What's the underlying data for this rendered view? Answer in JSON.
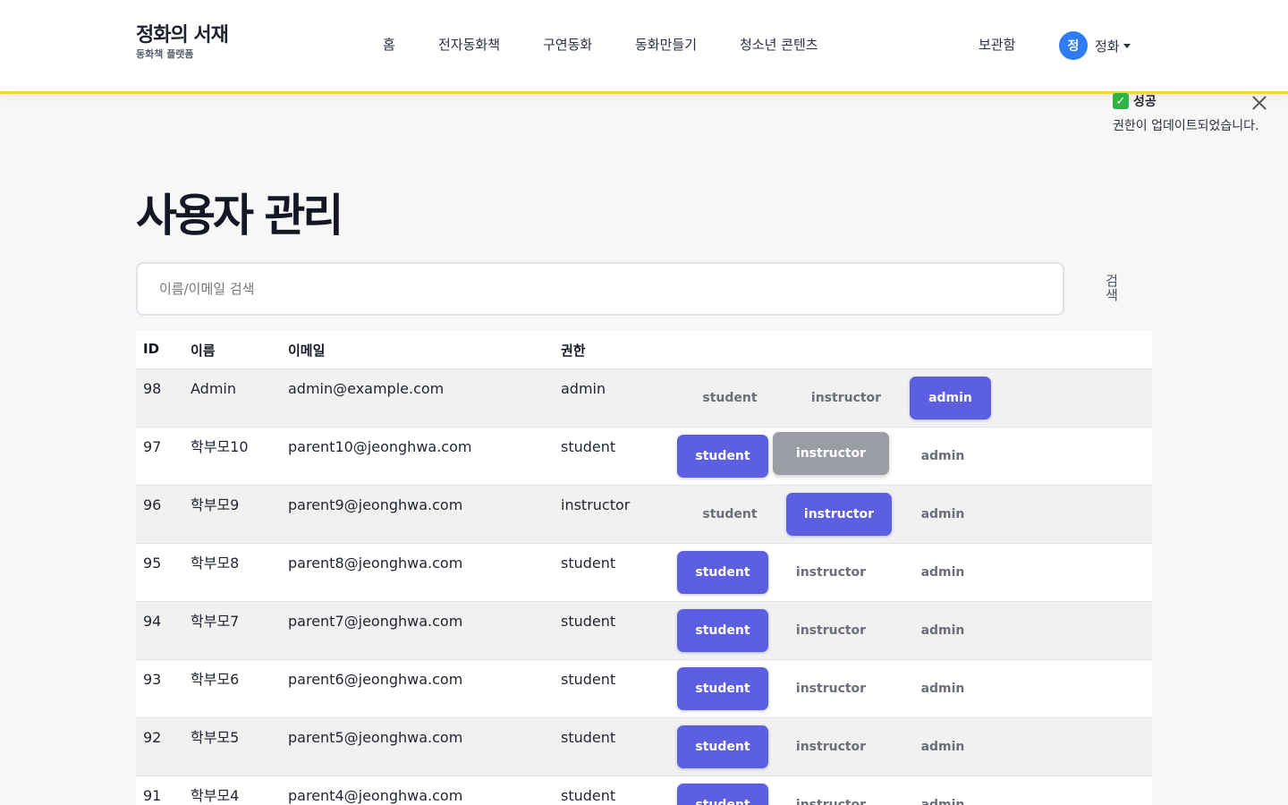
{
  "brand": {
    "title": "정화의 서재",
    "subtitle": "동화책 플랫폼"
  },
  "nav": [
    "홈",
    "전자동화책",
    "구연동화",
    "동화만들기",
    "청소년 콘텐츠"
  ],
  "header": {
    "locker": "보관함",
    "avatar_initial": "정",
    "user_name": "정화"
  },
  "toast": {
    "icon": "check-mark-icon",
    "title": "성공",
    "message": "권한이 업데이트되었습니다."
  },
  "page": {
    "title": "사용자 관리"
  },
  "search": {
    "placeholder": "이름/이메일 검색",
    "button_label": "검색"
  },
  "table": {
    "headers": {
      "id": "ID",
      "name": "이름",
      "email": "이메일",
      "role": "권한"
    },
    "role_options": [
      "student",
      "instructor",
      "admin"
    ],
    "rows": [
      {
        "id": "98",
        "name": "Admin",
        "email": "admin@example.com",
        "role": "admin"
      },
      {
        "id": "97",
        "name": "학부모10",
        "email": "parent10@jeonghwa.com",
        "role": "student",
        "hover": "instructor"
      },
      {
        "id": "96",
        "name": "학부모9",
        "email": "parent9@jeonghwa.com",
        "role": "instructor"
      },
      {
        "id": "95",
        "name": "학부모8",
        "email": "parent8@jeonghwa.com",
        "role": "student"
      },
      {
        "id": "94",
        "name": "학부모7",
        "email": "parent7@jeonghwa.com",
        "role": "student"
      },
      {
        "id": "93",
        "name": "학부모6",
        "email": "parent6@jeonghwa.com",
        "role": "student"
      },
      {
        "id": "92",
        "name": "학부모5",
        "email": "parent5@jeonghwa.com",
        "role": "student"
      },
      {
        "id": "91",
        "name": "학부모4",
        "email": "parent4@jeonghwa.com",
        "role": "student"
      }
    ]
  },
  "colors": {
    "accent": "#5b5fe0",
    "header_border": "#f4d23a",
    "avatar": "#2f7cf6",
    "success": "#2fb344"
  }
}
